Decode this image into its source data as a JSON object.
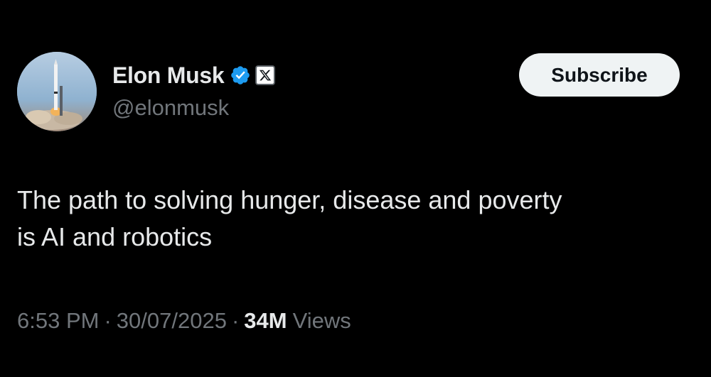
{
  "author": {
    "display_name": "Elon Musk",
    "handle": "@elonmusk",
    "verified": true,
    "verified_badge_color": "#1d9bf0",
    "affiliate_badge_icon": "x-logo-icon",
    "avatar_icon": "rocket-launch-avatar"
  },
  "actions": {
    "subscribe_label": "Subscribe"
  },
  "tweet": {
    "text": "The path to solving hunger, disease and poverty\nis AI and robotics"
  },
  "meta": {
    "time": "6:53 PM",
    "separator": "·",
    "date": "30/07/2025",
    "views_count": "34M",
    "views_label": "Views"
  },
  "colors": {
    "background": "#000000",
    "primary_text": "#e7e9ea",
    "secondary_text": "#71767b",
    "button_background": "#eff3f4",
    "button_text": "#0f1419"
  }
}
